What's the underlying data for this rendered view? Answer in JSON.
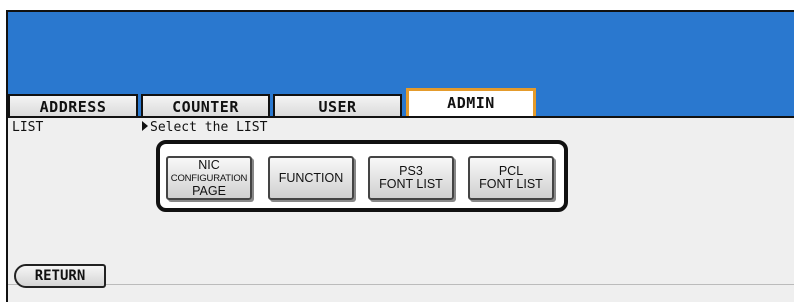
{
  "tabs": [
    {
      "label": "ADDRESS",
      "active": false
    },
    {
      "label": "COUNTER",
      "active": false
    },
    {
      "label": "USER",
      "active": false
    },
    {
      "label": "ADMIN",
      "active": true
    }
  ],
  "crumb": {
    "section": "LIST",
    "instruction": "Select the LIST"
  },
  "list_buttons": {
    "nic": [
      "NIC",
      "CONFIGURATION",
      "PAGE"
    ],
    "function": "FUNCTION",
    "ps3": [
      "PS3",
      "FONT LIST"
    ],
    "pcl": [
      "PCL",
      "FONT LIST"
    ]
  },
  "return_label": "RETURN",
  "colors": {
    "header_blue": "#2a78cf",
    "active_tab_border": "#e49b2c",
    "panel": "#efefef"
  }
}
